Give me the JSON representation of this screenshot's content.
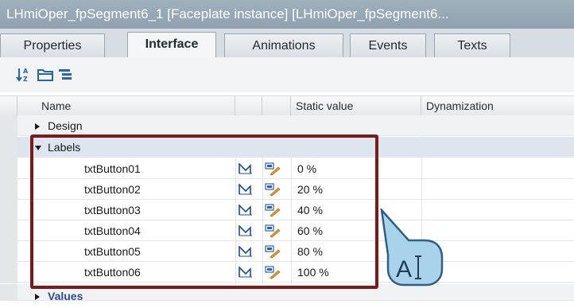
{
  "window": {
    "title": "LHmiOper_fpSegment6_1  [Faceplate  instance]  [LHmiOper_fpSegment6..."
  },
  "tabs": [
    {
      "label": "Properties",
      "active": false
    },
    {
      "label": "Interface",
      "active": true
    },
    {
      "label": "Animations",
      "active": false
    },
    {
      "label": "Events",
      "active": false
    },
    {
      "label": "Texts",
      "active": false
    }
  ],
  "toolbar": {
    "icons": [
      "sort-az-icon",
      "folder-icon",
      "list-tree-icon"
    ]
  },
  "table": {
    "columns": [
      "Name",
      "Static value",
      "Dynamization"
    ],
    "groups": [
      {
        "label": "Design",
        "expanded": false
      },
      {
        "label": "Labels",
        "expanded": true
      },
      {
        "label": "Values",
        "expanded": false
      }
    ],
    "rows": [
      {
        "name": "txtButton01",
        "static_value": "0 %"
      },
      {
        "name": "txtButton02",
        "static_value": "20 %"
      },
      {
        "name": "txtButton03",
        "static_value": "40 %"
      },
      {
        "name": "txtButton04",
        "static_value": "60 %"
      },
      {
        "name": "txtButton05",
        "static_value": "80 %"
      },
      {
        "name": "txtButton06",
        "static_value": "100 %"
      }
    ]
  },
  "callout": {
    "icon": "text-cursor-icon",
    "text": "A"
  },
  "colors": {
    "title_bar": "#9fb0bd",
    "highlight_border": "#7a1a1a",
    "callout_fill": "#a9d3ea",
    "callout_border": "#2f5f86",
    "values_link": "#2d4c9a"
  }
}
